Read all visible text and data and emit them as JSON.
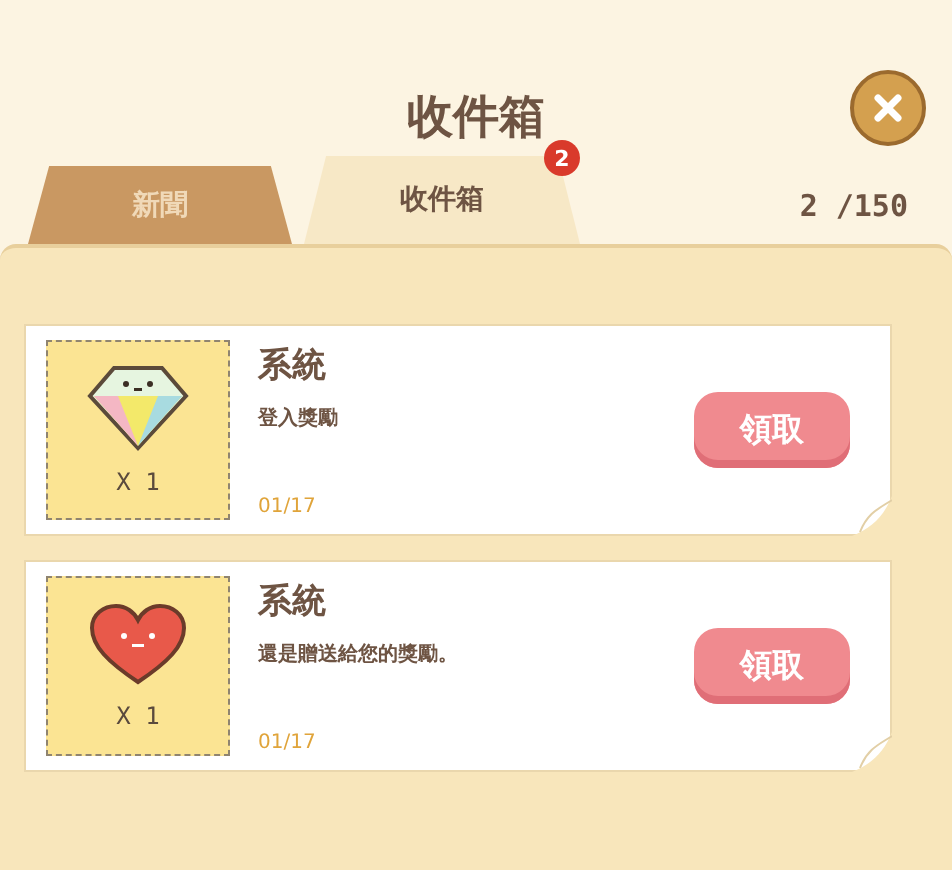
{
  "title": "收件箱",
  "tabs": [
    {
      "label": "新聞",
      "selected": false
    },
    {
      "label": "收件箱",
      "selected": true,
      "badge": "2"
    }
  ],
  "count": "2 /150",
  "messages": [
    {
      "kind": "diamond",
      "quantity": "X 1",
      "sender": "系統",
      "text": "登入獎勵",
      "date": "01/17",
      "action": "領取"
    },
    {
      "kind": "heart",
      "quantity": "X 1",
      "sender": "系統",
      "text": "還是贈送給您的獎勵。",
      "date": "01/17",
      "action": "領取"
    }
  ]
}
